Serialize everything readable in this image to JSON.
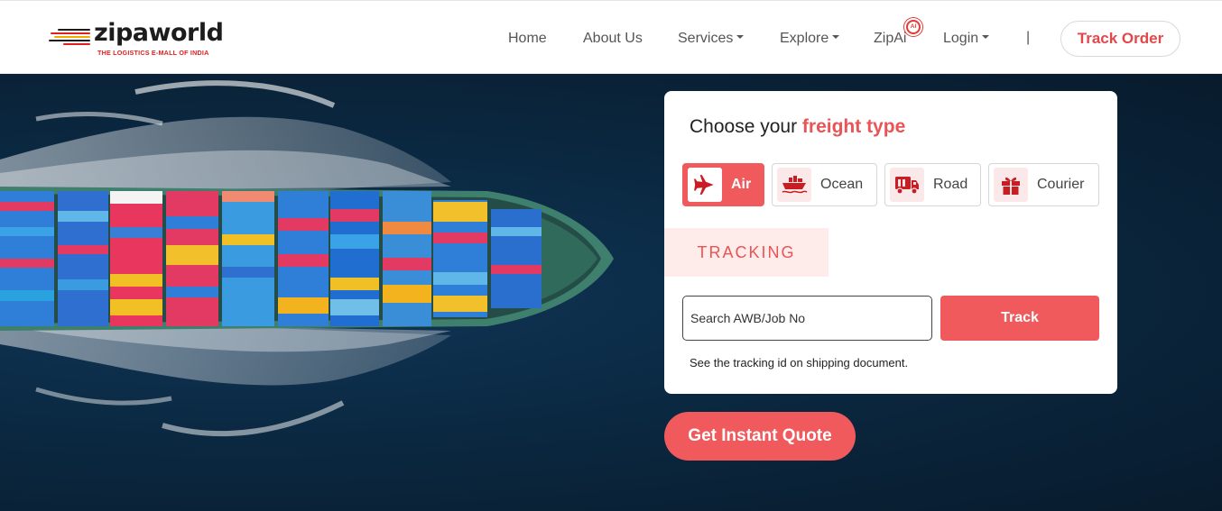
{
  "brand": {
    "name": "zipaworld",
    "tagline": "THE LOGISTICS E-MALL OF INDIA",
    "colors": {
      "primary": "#f05a5d",
      "accent": "#e95456",
      "dark": "#1c1c1c"
    }
  },
  "nav": {
    "home": "Home",
    "about": "About Us",
    "services": "Services",
    "explore": "Explore",
    "zipai": "ZipAi",
    "zipai_badge": "AI",
    "login": "Login",
    "separator": "|",
    "track_order": "Track Order"
  },
  "freight": {
    "title_prefix": "Choose your ",
    "title_accent": "freight type",
    "types": [
      {
        "label": "Air",
        "icon": "airplane-icon",
        "active": true
      },
      {
        "label": "Ocean",
        "icon": "ship-icon",
        "active": false
      },
      {
        "label": "Road",
        "icon": "truck-icon",
        "active": false
      },
      {
        "label": "Courier",
        "icon": "gift-box-icon",
        "active": false
      }
    ],
    "tracking_tab": "TRACKING",
    "search_placeholder": "Search AWB/Job No",
    "search_value": "",
    "track_button": "Track",
    "hint": "See the tracking id on shipping document."
  },
  "cta": {
    "quote": "Get Instant Quote"
  }
}
